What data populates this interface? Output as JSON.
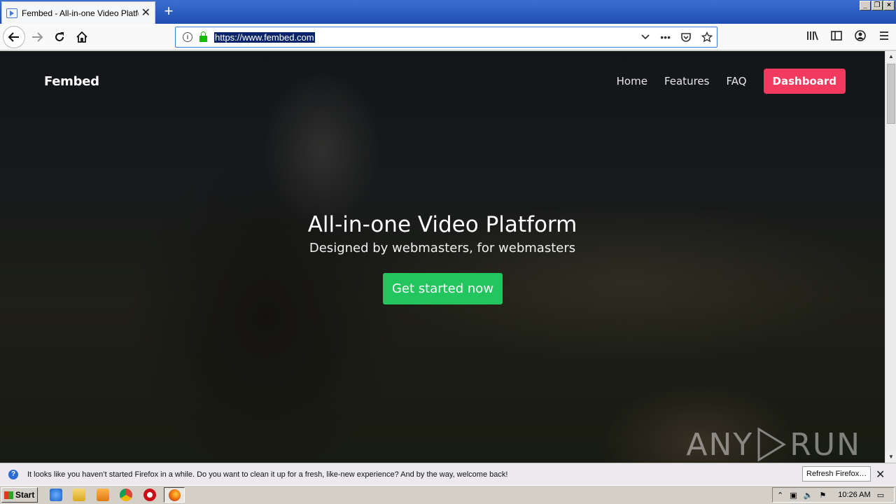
{
  "browser": {
    "tab_title": "Fembed - All-in-one Video Platform",
    "url": "https://www.fembed.com",
    "newtab_glyph": "+",
    "close_glyph": "✕"
  },
  "site": {
    "brand": "Fembed",
    "nav": [
      "Home",
      "Features",
      "FAQ"
    ],
    "dashboard_label": "Dashboard",
    "hero_title": "All-in-one Video Platform",
    "hero_subtitle": "Designed by webmasters, for webmasters",
    "cta_label": "Get started now"
  },
  "watermark": {
    "left": "ANY",
    "right": "RUN"
  },
  "notification": {
    "message": "It looks like you haven’t started Firefox in a while. Do you want to clean it up for a fresh, like-new experience? And by the way, welcome back!",
    "button_label": "Refresh Firefox…"
  },
  "taskbar": {
    "start_label": "Start",
    "clock": "10:26 AM"
  },
  "colors": {
    "dashboard": "#f23a5e",
    "cta": "#23c55e",
    "url_highlight": "#0a246a"
  }
}
